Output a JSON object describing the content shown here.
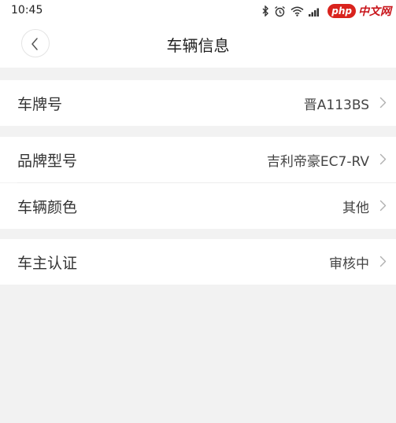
{
  "status_bar": {
    "time": "10:45",
    "icons": [
      "bluetooth-icon",
      "alarm-icon",
      "wifi-icon",
      "signal-icon"
    ],
    "watermark": {
      "badge": "php",
      "text": "中文网"
    }
  },
  "header": {
    "title": "车辆信息",
    "back_icon": "chevron-left-icon"
  },
  "rows": [
    {
      "label": "车牌号",
      "value": "晋A113BS"
    },
    {
      "label": "品牌型号",
      "value": "吉利帝豪EC7-RV"
    },
    {
      "label": "车辆颜色",
      "value": "其他"
    },
    {
      "label": "车主认证",
      "value": "审核中"
    }
  ],
  "colors": {
    "background": "#f2f2f2",
    "surface": "#ffffff",
    "text": "#333333",
    "chevron": "#b0b0b0",
    "watermark": "#d9231d"
  }
}
